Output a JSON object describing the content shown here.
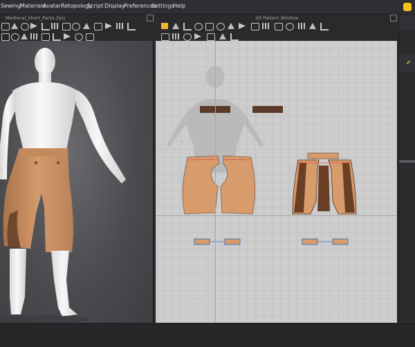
{
  "menu": {
    "items": [
      "Sewing",
      "Materials",
      "Avatar",
      "Retopology",
      "Script",
      "Display",
      "Preferences",
      "Settings",
      "Help"
    ]
  },
  "windows": {
    "view3d_title": "Medieval_Short_Pants.Zprj",
    "pattern_title": "2D Pattern Window"
  },
  "colors": {
    "fabric_front": "#d89b6c",
    "fabric_shadow": "#6a3f26",
    "waistband": "#5b3a2c",
    "accent": "#f2c21b",
    "avatar": "#f1f1f1"
  },
  "icons": {
    "app": "clo-logo-icon",
    "confirm": "checkmark-icon"
  }
}
